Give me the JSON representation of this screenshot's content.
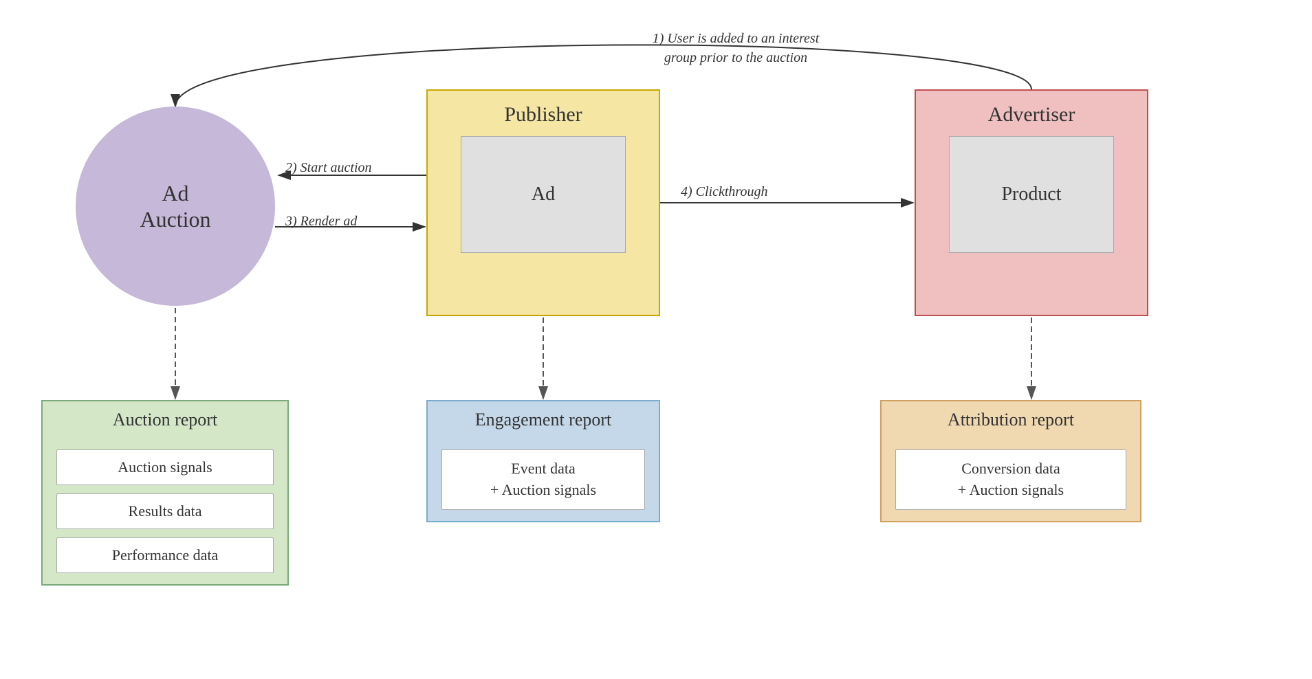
{
  "adAuction": {
    "label": "Ad\nAuction"
  },
  "publisher": {
    "title": "Publisher",
    "innerLabel": "Ad"
  },
  "advertiser": {
    "title": "Advertiser",
    "innerLabel": "Product"
  },
  "annotations": {
    "step1": "1) User is added to an interest\ngroup prior to the auction",
    "step2": "2) Start auction",
    "step3": "3) Render ad",
    "step4": "4) Clickthrough"
  },
  "auctionReport": {
    "title": "Auction report",
    "items": [
      "Auction signals",
      "Results data",
      "Performance data"
    ]
  },
  "engagementReport": {
    "title": "Engagement report",
    "items": [
      "Event data\n+ Auction signals"
    ]
  },
  "attributionReport": {
    "title": "Attribution report",
    "items": [
      "Conversion data\n+ Auction signals"
    ]
  }
}
